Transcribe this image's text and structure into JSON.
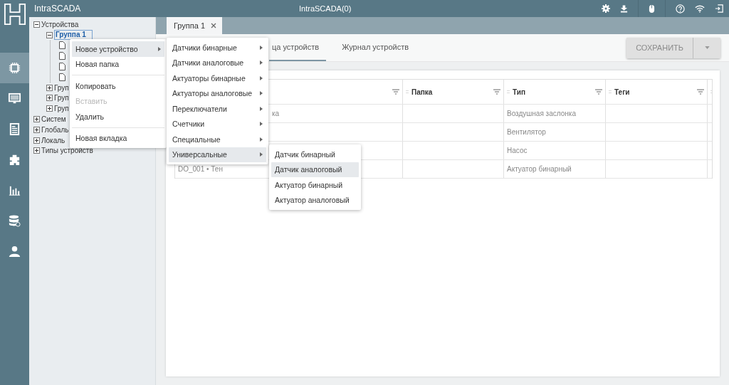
{
  "app": {
    "title": "IntraSCADA",
    "center_title": "IntraSCADA(0)"
  },
  "sidebar": {
    "items": [
      {
        "selected": true
      },
      {
        "selected": false
      },
      {
        "selected": false
      },
      {
        "selected": false
      },
      {
        "selected": false
      },
      {
        "selected": false
      },
      {
        "selected": false
      }
    ]
  },
  "tree": [
    {
      "kind": "folder",
      "label": "Устройства",
      "expanded": true,
      "selected": false,
      "children": [
        {
          "kind": "folder",
          "label": "Группа 1",
          "expanded": true,
          "selected": true,
          "children": [
            {
              "kind": "device"
            },
            {
              "kind": "device"
            },
            {
              "kind": "device"
            },
            {
              "kind": "device"
            }
          ]
        },
        {
          "kind": "folder",
          "label": "Груп",
          "expanded": false,
          "selected": false
        },
        {
          "kind": "folder",
          "label": "Груп",
          "expanded": false,
          "selected": false
        },
        {
          "kind": "folder",
          "label": "Груп",
          "expanded": false,
          "selected": false
        }
      ]
    },
    {
      "kind": "folder",
      "label": "Систем",
      "expanded": false,
      "selected": false
    },
    {
      "kind": "folder",
      "label": "Глобаль",
      "expanded": false,
      "selected": false
    },
    {
      "kind": "folder",
      "label": "Локаль",
      "expanded": false,
      "selected": false
    },
    {
      "kind": "folder",
      "label": "Типы устройств",
      "expanded": false,
      "selected": false
    }
  ],
  "tabs": [
    {
      "label": "Группа 1",
      "selected": true
    }
  ],
  "subtabs": [
    {
      "label": "ца устройств",
      "selected": true
    },
    {
      "label": "Журнал устройств",
      "selected": false
    }
  ],
  "save_button": {
    "label": "СОХРАНИТЬ",
    "disabled": true
  },
  "table": {
    "columns": [
      "Папка",
      "Тип",
      "Теги"
    ],
    "rows": [
      {
        "column_1": "ка",
        "type": "Воздушная заслонка"
      },
      {
        "type": "Вентилятор"
      },
      {
        "type": "Насос"
      },
      {
        "column_1": "DO_001 • Тен",
        "type": "Актуатор бинарный"
      }
    ]
  },
  "context_menu": {
    "items": [
      {
        "kind": "item",
        "label": "Новое устройство",
        "submenu": true,
        "selected": true,
        "disabled": false
      },
      {
        "kind": "item",
        "label": "Новая папка",
        "submenu": false,
        "selected": false,
        "disabled": false
      },
      {
        "kind": "divider"
      },
      {
        "kind": "item",
        "label": "Копировать",
        "submenu": false,
        "selected": false,
        "disabled": false
      },
      {
        "kind": "item",
        "label": "Вставить",
        "submenu": false,
        "selected": false,
        "disabled": true
      },
      {
        "kind": "item",
        "label": "Удалить",
        "submenu": false,
        "selected": false,
        "disabled": false
      },
      {
        "kind": "divider"
      },
      {
        "kind": "item",
        "label": "Новая вкладка",
        "submenu": false,
        "selected": false,
        "disabled": false
      }
    ]
  },
  "submenu": {
    "items": [
      {
        "kind": "item",
        "label": "Датчики бинарные",
        "submenu": true,
        "selected": false,
        "disabled": false
      },
      {
        "kind": "item",
        "label": "Датчики аналоговые",
        "submenu": true,
        "selected": false,
        "disabled": false
      },
      {
        "kind": "item",
        "label": "Актуаторы бинарные",
        "submenu": true,
        "selected": false,
        "disabled": false
      },
      {
        "kind": "item",
        "label": "Актуаторы аналоговые",
        "submenu": true,
        "selected": false,
        "disabled": false
      },
      {
        "kind": "item",
        "label": "Переключатели",
        "submenu": true,
        "selected": false,
        "disabled": false
      },
      {
        "kind": "item",
        "label": "Счетчики",
        "submenu": true,
        "selected": false,
        "disabled": false
      },
      {
        "kind": "item",
        "label": "Специальные",
        "submenu": true,
        "selected": false,
        "disabled": false
      },
      {
        "kind": "item",
        "label": "Универсальные",
        "submenu": true,
        "selected": true,
        "disabled": false
      }
    ]
  },
  "submenu_2": {
    "items": [
      {
        "kind": "item",
        "label": "Датчик бинарный",
        "submenu": false,
        "selected": false,
        "disabled": false
      },
      {
        "kind": "item",
        "label": "Датчик аналоговый",
        "submenu": false,
        "selected": true,
        "disabled": false
      },
      {
        "kind": "item",
        "label": "Актуатор бинарный",
        "submenu": false,
        "selected": false,
        "disabled": false
      },
      {
        "kind": "item",
        "label": "Актуатор аналоговый",
        "submenu": false,
        "selected": false,
        "disabled": false
      }
    ]
  }
}
